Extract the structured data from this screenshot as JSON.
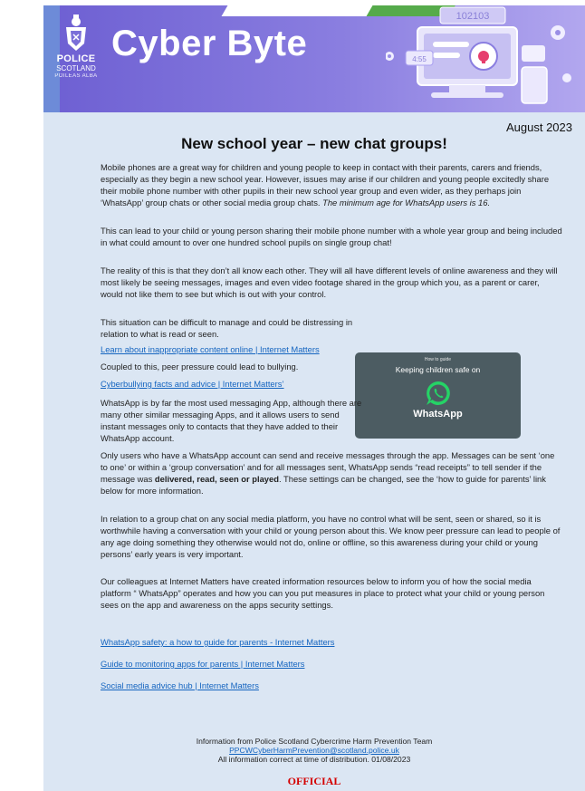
{
  "banner": {
    "logo_line1": "POLICE",
    "logo_line2": "SCOTLAND",
    "logo_line3": "POILEAS ALBA",
    "title": "Cyber Byte",
    "screen_number": "102103",
    "mini_number": "4:55"
  },
  "date": "August 2023",
  "headline": "New school year – new chat groups!",
  "p1": "Mobile phones are a great way for children and young people to keep in contact with their parents, carers and friends, especially as they begin a new school year. However, issues may arise if our children and young people excitedly share their mobile phone number with other pupils in their new school year group and even wider, as they perhaps join ‘WhatsApp’ group chats or other social media group chats.",
  "p1_italic": "The minimum age for WhatsApp users is 16.",
  "p2": "This can lead to your child or young person sharing their mobile phone number with a whole year group and being included in what could amount to over one hundred school pupils on single group chat!",
  "p3": "The reality of this is that they don’t all know each other. They will all have different levels of online awareness and they will most likely be seeing messages, images and even video footage shared in the group which you, as a parent or carer, would not like them to see but which is out with your control.",
  "p4": "This situation can be difficult to manage and could be distressing in relation to what is read or seen.",
  "link1": "Learn about inappropriate content online | Internet Matters",
  "p5": "Coupled to this, peer pressure could lead to bullying.",
  "link2": "Cyberbullying facts and advice | Internet Matters’",
  "p6": "WhatsApp is by far the most used messaging App, although there are many other similar messaging Apps, and it allows users to send instant messages only to contacts that they have added to their WhatsApp account.",
  "p7_a": "Only users who have a WhatsApp account can send and receive messages through the app. Messages can be sent ‘one to one’ or within a ‘group conversation’ and for all messages sent, WhatsApp sends “read receipts” to tell sender if the message was ",
  "p7_bold": "delivered, read, seen or played",
  "p7_b": ". These settings can be changed, see the ‘how to guide for parents’ link below for more information.",
  "p8": "In relation to a group chat on any social media platform, you have no control what will be sent, seen or shared, so it is worthwhile having a conversation with your child or young person about this. We know peer pressure can lead to people of any age doing something they otherwise would not do, online or offline, so this awareness during your child or young persons’ early years is very important.",
  "p9": "Our colleagues at Internet Matters have created information resources below to inform you of how the social media platform “ WhatsApp” operates and how you can you put measures in place to protect what your child or young person sees on the app and awareness on the apps security settings.",
  "link3": "WhatsApp safety: a how to guide for parents - Internet Matters",
  "link4": "Guide to monitoring apps for parents | Internet Matters",
  "link5": "Social media advice hub | Internet Matters",
  "card": {
    "small": "How to guide",
    "heading": "Keeping children safe on",
    "brand": "WhatsApp"
  },
  "footer": {
    "line1": "Information from Police Scotland Cybercrime Harm Prevention Team",
    "email": "PPCWCyberHarmPrevention@scotland.police.uk",
    "line3": "All information correct at time of distribution. 01/08/2023"
  },
  "official": "OFFICIAL"
}
